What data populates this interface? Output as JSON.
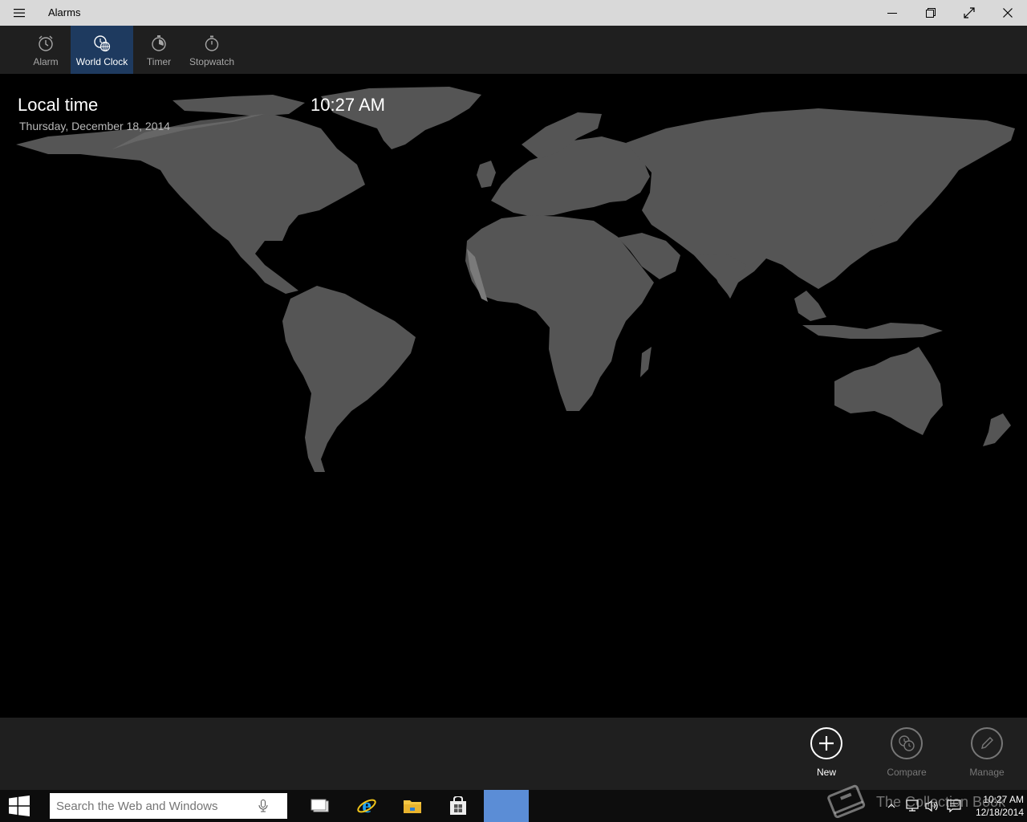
{
  "window": {
    "title": "Alarms"
  },
  "tabs": [
    {
      "label": "Alarm",
      "icon": "alarm-clock-icon",
      "selected": false
    },
    {
      "label": "World Clock",
      "icon": "world-clock-icon",
      "selected": true
    },
    {
      "label": "Timer",
      "icon": "timer-icon",
      "selected": false
    },
    {
      "label": "Stopwatch",
      "icon": "stopwatch-icon",
      "selected": false
    }
  ],
  "local": {
    "label": "Local time",
    "date": "Thursday, December 18, 2014",
    "time": "10:27 AM"
  },
  "appbar": {
    "new_label": "New",
    "compare_label": "Compare",
    "manage_label": "Manage"
  },
  "taskbar": {
    "search_placeholder": "Search the Web and Windows",
    "clock_time": "10:27 AM",
    "clock_date": "12/18/2014"
  },
  "watermark": {
    "text": "The Collection Book"
  },
  "colors": {
    "titlebar": "#d9d9d9",
    "toolbar": "#1f1f1f",
    "selected_tab": "#1e3a5f",
    "land": "#555555",
    "land_day": "#6e6e6e",
    "taskbar_active": "#5b8dd6"
  }
}
